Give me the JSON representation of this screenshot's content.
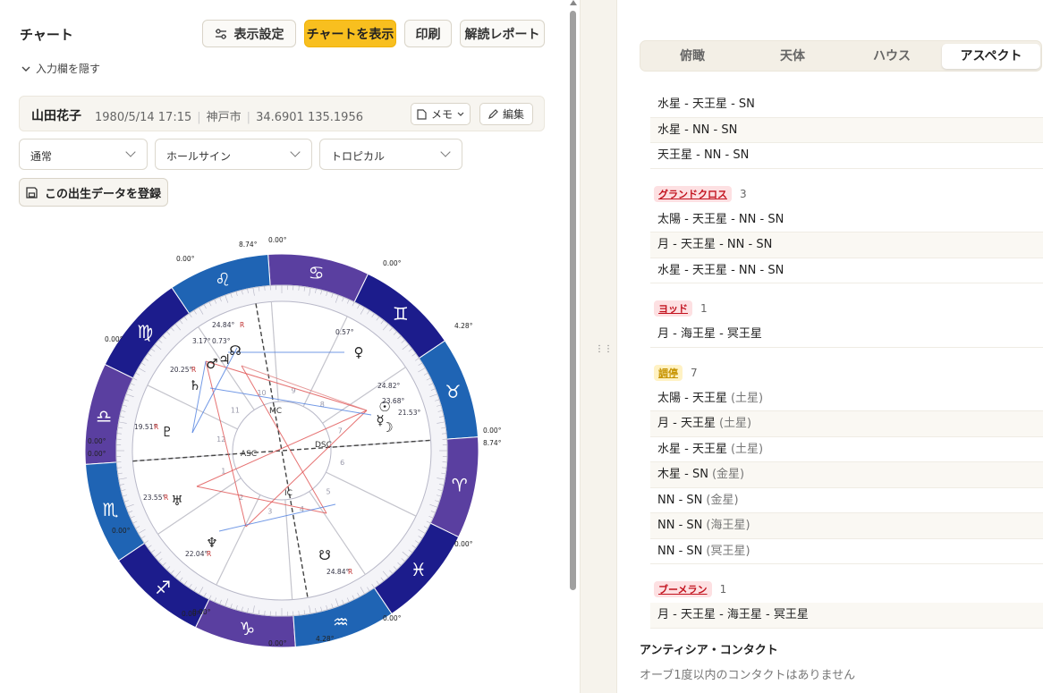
{
  "header": {
    "title": "チャート",
    "display_settings": "表示設定",
    "show_chart": "チャートを表示",
    "print": "印刷",
    "report": "解読レポート",
    "hide_inputs": "入力欄を隠す"
  },
  "profile": {
    "name": "山田花子",
    "date": "1980/5/14 17:15",
    "place": "神戸市",
    "coords": "34.6901 135.1956",
    "memo_label": "メモ",
    "edit_label": "編集"
  },
  "selects": {
    "mode": "通常",
    "house_system": "ホールサイン",
    "zodiac": "トロピカル"
  },
  "register_label": "この出生データを登録",
  "chart": {
    "angle_labels": {
      "asc": "ASC",
      "dsc": "DSC",
      "mc": "MC",
      "ic": "IC"
    },
    "cusp_degree_labels": [
      "8.74°",
      "0.00°",
      "0.00°",
      "0.00°",
      "0.00°",
      "4.28°",
      "0.00°",
      "0.00°",
      "0.00°",
      "8.74°",
      "0.00°",
      "0.00°",
      "0.00°",
      "0.00°",
      "4.28°",
      "0.00°",
      "0.00°"
    ],
    "planet_degree_labels": [
      "24.84°",
      "R",
      "3.17°",
      "0.73°",
      "20.25°",
      "R",
      "19.51°",
      "R",
      "23.55°",
      "R",
      "22.04°",
      "R",
      "24.84°",
      "R",
      "0.57°",
      "24.82°",
      "23.68°",
      "21.53°"
    ],
    "house_numbers": [
      "1",
      "2",
      "3",
      "4",
      "5",
      "6",
      "7",
      "8",
      "9",
      "10",
      "11",
      "12"
    ],
    "signs": [
      {
        "name": "leo-sign",
        "glyph": "♌"
      },
      {
        "name": "cancer-sign",
        "glyph": "♋"
      },
      {
        "name": "gemini-sign",
        "glyph": "♊"
      },
      {
        "name": "taurus-sign",
        "glyph": "♉"
      },
      {
        "name": "aries-sign",
        "glyph": "♈"
      },
      {
        "name": "pisces-sign",
        "glyph": "♓"
      },
      {
        "name": "aquarius-sign",
        "glyph": "♒"
      },
      {
        "name": "capricorn-sign",
        "glyph": "♑"
      },
      {
        "name": "sagittarius-sign",
        "glyph": "♐"
      },
      {
        "name": "scorpio-sign",
        "glyph": "♏"
      },
      {
        "name": "libra-sign",
        "glyph": "♎"
      },
      {
        "name": "virgo-sign",
        "glyph": "♍"
      }
    ],
    "planets": [
      {
        "name": "mars-glyph",
        "glyph": "♂"
      },
      {
        "name": "jupiter-glyph",
        "glyph": "♃"
      },
      {
        "name": "node-glyph",
        "glyph": "☊"
      },
      {
        "name": "saturn-glyph",
        "glyph": "♄"
      },
      {
        "name": "pluto-glyph",
        "glyph": "♇"
      },
      {
        "name": "uranus-glyph",
        "glyph": "♅"
      },
      {
        "name": "neptune-glyph",
        "glyph": "♆"
      },
      {
        "name": "south-node-glyph",
        "glyph": "☋"
      },
      {
        "name": "venus-glyph",
        "glyph": "♀"
      },
      {
        "name": "mercury-glyph",
        "glyph": "☿"
      },
      {
        "name": "sun-glyph",
        "glyph": "☉"
      },
      {
        "name": "moon-glyph",
        "glyph": "☽"
      }
    ]
  },
  "tabs": [
    "俯瞰",
    "天体",
    "ハウス",
    "アスペクト"
  ],
  "aspects": {
    "top_rows": [
      "水星 - 天王星 - SN",
      "水星 - NN - SN",
      "天王星 - NN - SN"
    ],
    "groups": [
      {
        "label": "グランドクロス",
        "count": "3",
        "style": "red",
        "rows": [
          "太陽 - 天王星 - NN - SN",
          "月 - 天王星 - NN - SN",
          "水星 - 天王星 - NN - SN"
        ]
      },
      {
        "label": "ヨッド",
        "count": "1",
        "style": "red",
        "rows": [
          "月 - 海王星 - 冥王星"
        ]
      },
      {
        "label": "調停",
        "count": "7",
        "style": "yellow",
        "rows": [
          {
            "text": "太陽 - 天王星",
            "paren": "(土星)"
          },
          {
            "text": "月 - 天王星",
            "paren": "(土星)"
          },
          {
            "text": "水星 - 天王星",
            "paren": "(土星)"
          },
          {
            "text": "木星 - SN",
            "paren": "(金星)"
          },
          {
            "text": "NN - SN",
            "paren": "(金星)"
          },
          {
            "text": "NN - SN",
            "paren": "(海王星)"
          },
          {
            "text": "NN - SN",
            "paren": "(冥王星)"
          }
        ]
      },
      {
        "label": "ブーメラン",
        "count": "1",
        "style": "red",
        "rows": [
          "月 - 天王星 - 海王星 - 冥王星"
        ]
      }
    ]
  },
  "antiscia": {
    "title": "アンティシア・コンタクト",
    "text": "オーブ1度以内のコンタクトはありません"
  },
  "colors": {
    "accent": "#f8bf1f",
    "wheel_dark": "#1c1c8c",
    "wheel_purple": "#5a3fa0",
    "wheel_blue": "#1f64b4"
  }
}
